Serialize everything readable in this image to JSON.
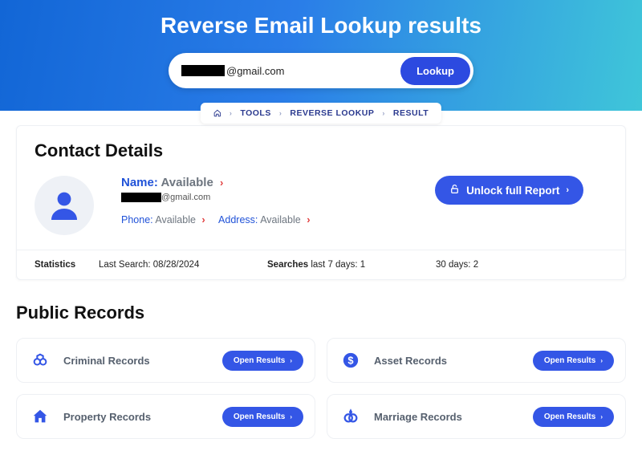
{
  "hero": {
    "title": "Reverse Email Lookup results",
    "search_suffix": "@gmail.com",
    "lookup_label": "Lookup"
  },
  "breadcrumb": {
    "items": [
      "TOOLS",
      "REVERSE LOOKUP",
      "RESULT"
    ]
  },
  "contact": {
    "heading": "Contact Details",
    "name_label": "Name:",
    "name_value": "Available",
    "email_suffix": "@gmail.com",
    "phone_label": "Phone:",
    "phone_value": "Available",
    "address_label": "Address:",
    "address_value": "Available",
    "unlock_label": "Unlock full Report"
  },
  "stats": {
    "label": "Statistics",
    "last_search_label": "Last Search:",
    "last_search_value": "08/28/2024",
    "searches_label": "Searches",
    "last7_label": "last 7 days:",
    "last7_value": "1",
    "days30_label": "30 days:",
    "days30_value": "2"
  },
  "records": {
    "heading": "Public Records",
    "open_label": "Open Results",
    "items": [
      {
        "label": "Criminal Records"
      },
      {
        "label": "Asset Records"
      },
      {
        "label": "Property Records"
      },
      {
        "label": "Marriage Records"
      }
    ]
  }
}
